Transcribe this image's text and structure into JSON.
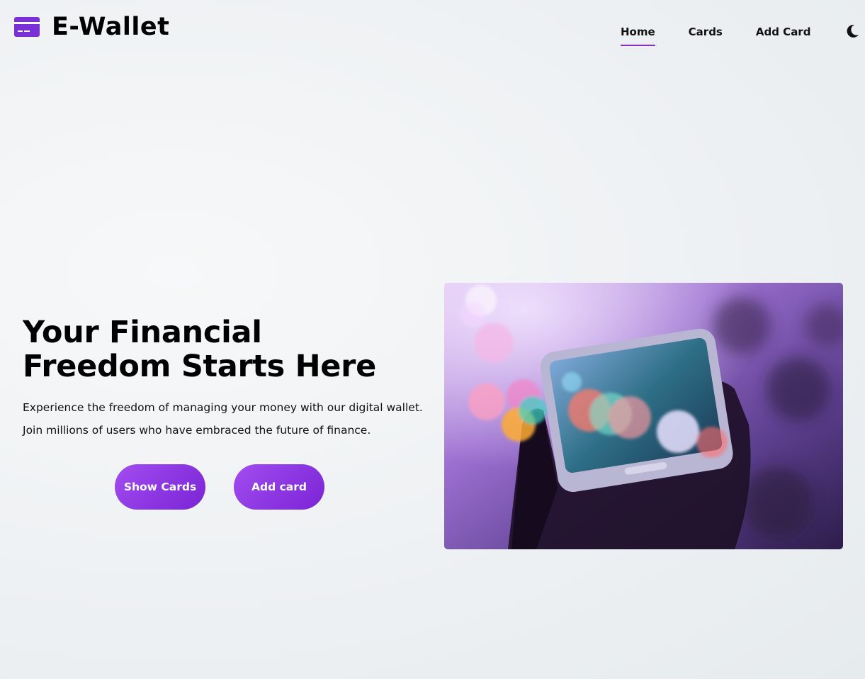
{
  "brand": {
    "name": "E-Wallet",
    "icon": "credit-card-icon",
    "color": "#7b2fd6"
  },
  "nav": {
    "items": [
      {
        "label": "Home",
        "active": true
      },
      {
        "label": "Cards",
        "active": false
      },
      {
        "label": "Add Card",
        "active": false
      }
    ],
    "theme_toggle_icon": "moon-icon",
    "accent": "#8a2be2"
  },
  "hero": {
    "title": "Your Financial Freedom Starts Here",
    "description": "Experience the freedom of managing your money with our digital wallet. Join millions of users who have embraced the future of finance.",
    "buttons": {
      "show_cards": "Show Cards",
      "add_card": "Add card"
    },
    "image_subject": "hand-holding-smartphone-with-bokeh-lights"
  },
  "colors": {
    "button_gradient_start": "#a24cf0",
    "button_gradient_end": "#7a24d6"
  }
}
